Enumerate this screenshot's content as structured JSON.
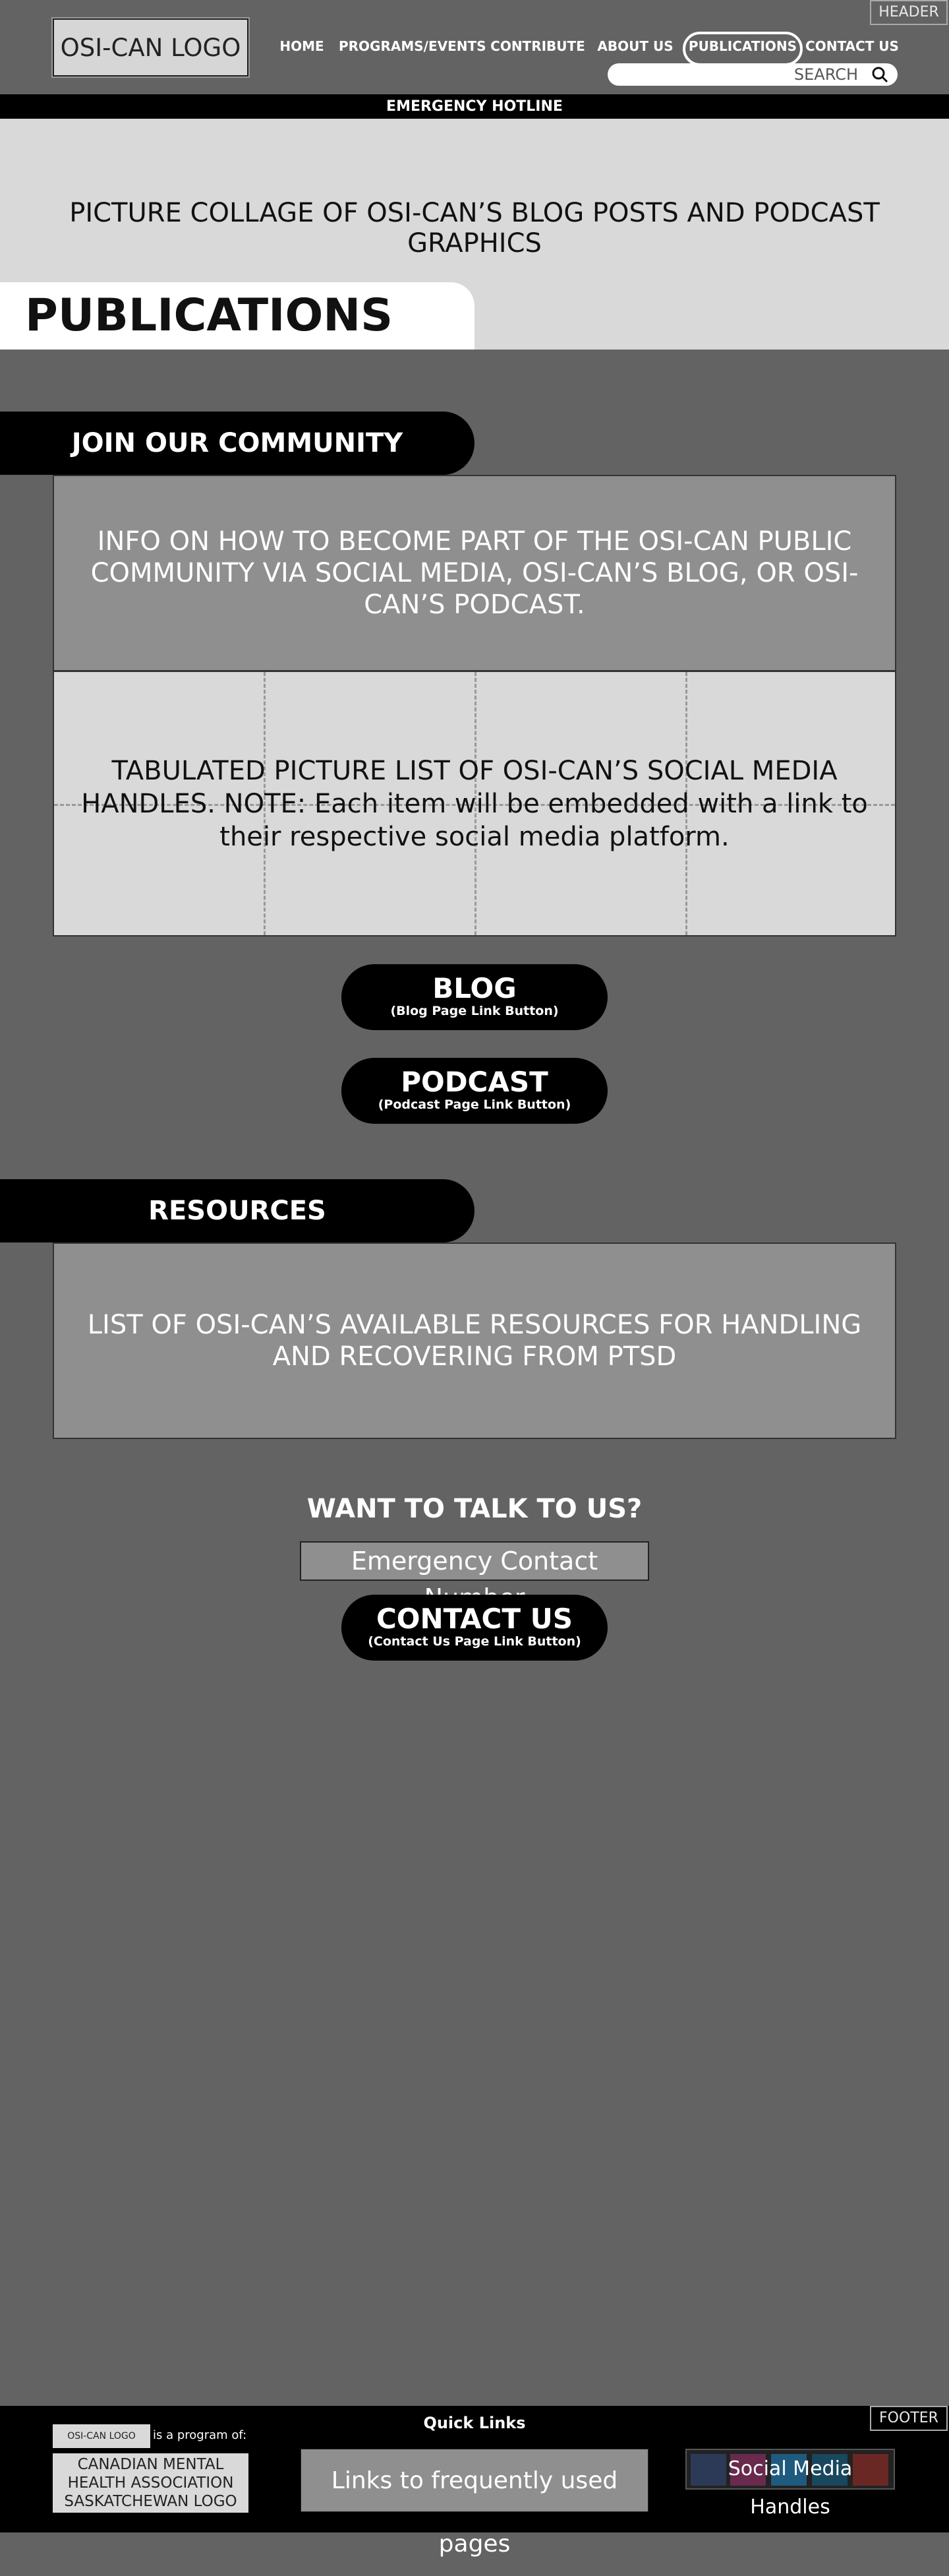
{
  "header": {
    "tag": "HEADER",
    "logo": "OSI-CAN LOGO",
    "nav": [
      "HOME",
      "PROGRAMS/EVENTS",
      "CONTRIBUTE",
      "ABOUT US",
      "PUBLICATIONS",
      "CONTACT US"
    ],
    "active_nav": "PUBLICATIONS",
    "search_placeholder": "SEARCH",
    "hotline": "EMERGENCY HOTLINE"
  },
  "hero": {
    "collage_text": "PICTURE COLLAGE OF OSI-CAN’S BLOG POSTS AND PODCAST GRAPHICS",
    "page_title": "PUBLICATIONS"
  },
  "community": {
    "heading": "JOIN OUR COMMUNITY",
    "info": "INFO ON HOW TO BECOME PART OF THE OSI-CAN PUBLIC COMMUNITY VIA SOCIAL MEDIA, OSI-CAN’S BLOG, OR OSI-CAN’S PODCAST.",
    "handles_text": "TABULATED PICTURE LIST OF OSI-CAN’S SOCIAL MEDIA HANDLES. NOTE: Each item will be embedded with a link to their respective social media platform.",
    "blog_button": {
      "label": "BLOG",
      "sub": "(Blog Page Link Button)"
    },
    "podcast_button": {
      "label": "PODCAST",
      "sub": "(Podcast Page Link Button)"
    }
  },
  "resources": {
    "heading": "RESOURCES",
    "info": "LIST OF OSI-CAN’S AVAILABLE RESOURCES FOR HANDLING AND RECOVERING FROM PTSD"
  },
  "contact": {
    "heading": "WANT TO TALK TO US?",
    "emergency_number": "Emergency Contact Number",
    "button": {
      "label": "CONTACT US",
      "sub": "(Contact Us Page Link Button)"
    }
  },
  "footer": {
    "tag": "FOOTER",
    "quick_links": "Quick Links",
    "logo_small": "OSI-CAN LOGO",
    "program_of": "is a program of:",
    "cmha": "CANADIAN MENTAL HEALTH ASSOCIATION SASKATCHEWAN LOGO",
    "links": "Links to frequently used pages",
    "social": "Social Media Handles",
    "social_colors": [
      "#3b5998",
      "#c13584",
      "#1da1f2",
      "#0e76a8",
      "#c4302b"
    ]
  }
}
